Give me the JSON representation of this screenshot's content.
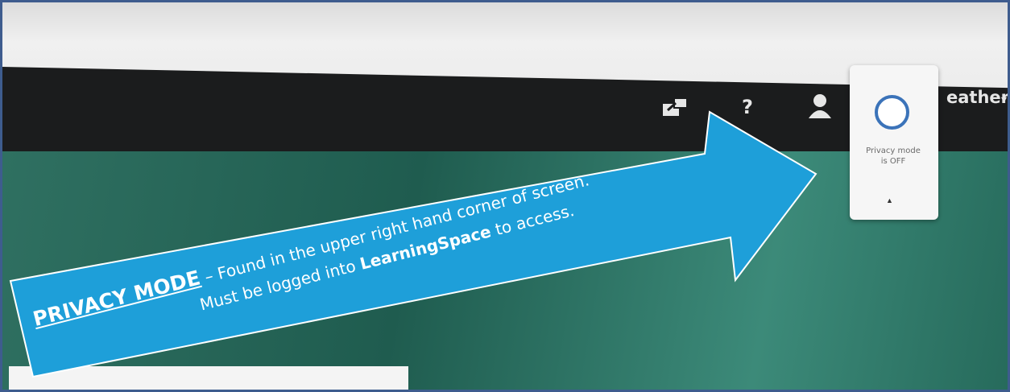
{
  "navbar": {
    "share_icon": "share-icon",
    "help_label": "?",
    "user_icon": "user-icon",
    "user_name_fragment": "eather",
    "caret": "▾"
  },
  "privacy_popup": {
    "status_line1": "Privacy mode",
    "status_line2": "is OFF",
    "collapse_glyph": "▲",
    "toggle_color": "#3b73b9"
  },
  "callout": {
    "title": "PRIVACY MODE",
    "line1_rest": " – Found in  the upper right hand corner of screen.",
    "line2_prefix": "Must be logged into ",
    "line2_bold": "LearningSpace",
    "line2_suffix": " to access.",
    "arrow_color": "#1e9fd9"
  },
  "colors": {
    "frame_border": "#3e5c8e",
    "navbar_bg": "#1b1c1d",
    "screen_bg": "#2f7061"
  }
}
